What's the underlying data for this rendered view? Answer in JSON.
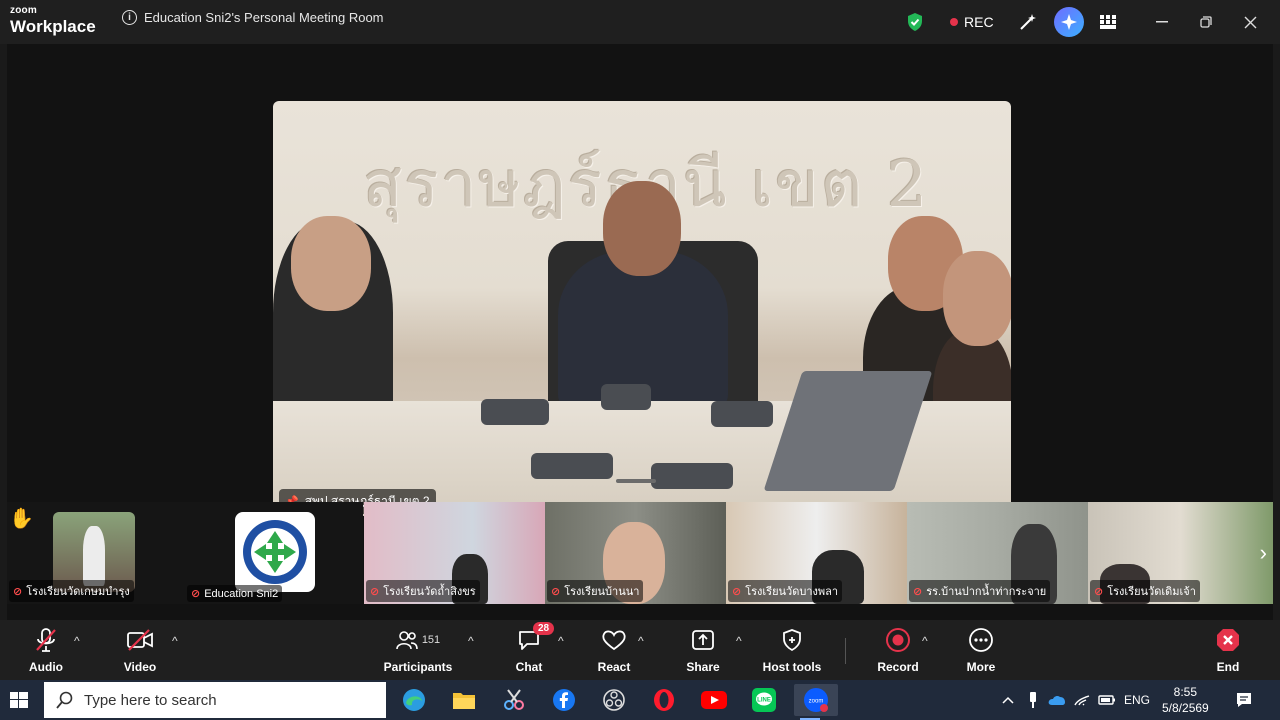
{
  "app": {
    "brand_small": "zoom",
    "brand_big": "Workplace",
    "meeting_title": "Education Sni2's Personal Meeting Room",
    "rec_label": "REC",
    "accent": "#0b5cff",
    "rec_color": "#e5334b"
  },
  "main_video": {
    "wall_text": "สุราษฎร์ธานี เขต 2",
    "pinned_name": "สพป.สุราษฎร์ธานี เขต 2"
  },
  "gallery": [
    {
      "name": "โรงเรียนวัดเกษมบำรุง",
      "hand_raised": true
    },
    {
      "name": "Education Sni2"
    },
    {
      "name": "โรงเรียนวัดถ้ำสิงขร"
    },
    {
      "name": "โรงเรียนบ้านนา"
    },
    {
      "name": "โรงเรียนวัดบางพลา"
    },
    {
      "name": "รร.บ้านปากน้ำท่ากระจาย"
    },
    {
      "name": "โรงเรียนวัดเดิมเจ้า"
    }
  ],
  "toolbar": {
    "audio": "Audio",
    "video": "Video",
    "participants": "Participants",
    "participants_count": "151",
    "chat": "Chat",
    "chat_badge": "28",
    "react": "React",
    "share": "Share",
    "host_tools": "Host tools",
    "record": "Record",
    "more": "More",
    "end": "End"
  },
  "taskbar": {
    "search_placeholder": "Type here to search",
    "language": "ENG",
    "time": "8:55",
    "date": "5/8/2569"
  }
}
